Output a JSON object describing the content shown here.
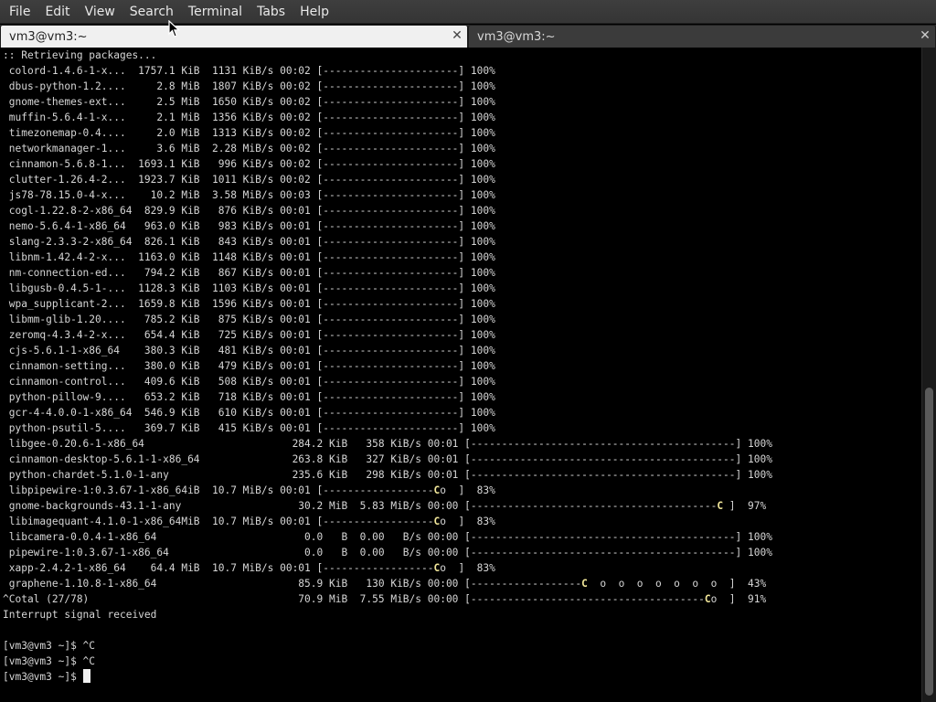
{
  "menu": [
    "File",
    "Edit",
    "View",
    "Search",
    "Terminal",
    "Tabs",
    "Help"
  ],
  "tabs": [
    {
      "title": "vm3@vm3:~",
      "active": true
    },
    {
      "title": "vm3@vm3:~",
      "active": false
    }
  ],
  "icons": {
    "tab_close": "close-icon",
    "pointer": "mouse-pointer-icon"
  },
  "colors": {
    "highlight": "#f2e79a",
    "text": "#d6d6d6",
    "background": "#000000"
  },
  "scrollbar": {
    "visible_fraction": 0.48,
    "position_fraction": 1.0
  },
  "terminal_lines": [
    ":: Retrieving packages...",
    " colord-1.4.6-1-x...  1757.1 KiB  1131 KiB/s 00:02 [----------------------] 100%",
    " dbus-python-1.2....     2.8 MiB  1807 KiB/s 00:02 [----------------------] 100%",
    " gnome-themes-ext...     2.5 MiB  1650 KiB/s 00:02 [----------------------] 100%",
    " muffin-5.6.4-1-x...     2.1 MiB  1356 KiB/s 00:02 [----------------------] 100%",
    " timezonemap-0.4....     2.0 MiB  1313 KiB/s 00:02 [----------------------] 100%",
    " networkmanager-1...     3.6 MiB  2.28 MiB/s 00:02 [----------------------] 100%",
    " cinnamon-5.6.8-1...  1693.1 KiB   996 KiB/s 00:02 [----------------------] 100%",
    " clutter-1.26.4-2...  1923.7 KiB  1011 KiB/s 00:02 [----------------------] 100%",
    " js78-78.15.0-4-x...    10.2 MiB  3.58 MiB/s 00:03 [----------------------] 100%",
    " cogl-1.22.8-2-x86_64  829.9 KiB   876 KiB/s 00:01 [----------------------] 100%",
    " nemo-5.6.4-1-x86_64   963.0 KiB   983 KiB/s 00:01 [----------------------] 100%",
    " slang-2.3.3-2-x86_64  826.1 KiB   843 KiB/s 00:01 [----------------------] 100%",
    " libnm-1.42.4-2-x...  1163.0 KiB  1148 KiB/s 00:01 [----------------------] 100%",
    " nm-connection-ed...   794.2 KiB   867 KiB/s 00:01 [----------------------] 100%",
    " libgusb-0.4.5-1-...  1128.3 KiB  1103 KiB/s 00:01 [----------------------] 100%",
    " wpa_supplicant-2...  1659.8 KiB  1596 KiB/s 00:01 [----------------------] 100%",
    " libmm-glib-1.20....   785.2 KiB   875 KiB/s 00:01 [----------------------] 100%",
    " zeromq-4.3.4-2-x...   654.4 KiB   725 KiB/s 00:01 [----------------------] 100%",
    " cjs-5.6.1-1-x86_64    380.3 KiB   481 KiB/s 00:01 [----------------------] 100%",
    " cinnamon-setting...   380.0 KiB   479 KiB/s 00:01 [----------------------] 100%",
    " cinnamon-control...   409.6 KiB   508 KiB/s 00:01 [----------------------] 100%",
    " python-pillow-9....   653.2 KiB   718 KiB/s 00:01 [----------------------] 100%",
    " gcr-4-4.0.0-1-x86_64  546.9 KiB   610 KiB/s 00:01 [----------------------] 100%",
    " python-psutil-5....   369.7 KiB   415 KiB/s 00:01 [----------------------] 100%",
    " libgee-0.20.6-1-x86_64                        284.2 KiB   358 KiB/s 00:01 [-------------------------------------------] 100%",
    " cinnamon-desktop-5.6.1-1-x86_64               263.8 KiB   327 KiB/s 00:01 [-------------------------------------------] 100%",
    " python-chardet-5.1.0-1-any                    235.6 KiB   298 KiB/s 00:01 [-------------------------------------------] 100%",
    " libpipewire-1:0.3.67-1-x86_64iB  10.7 MiB/s 00:01 [------------------Co  ]  83%",
    " gnome-backgrounds-43.1-1-any                   30.2 MiB  5.83 MiB/s 00:00 [----------------------------------------C ]  97%",
    " libimagequant-4.1.0-1-x86_64MiB  10.7 MiB/s 00:01 [------------------Co  ]  83%",
    " libcamera-0.0.4-1-x86_64                        0.0   B  0.00   B/s 00:00 [-------------------------------------------] 100%",
    " pipewire-1:0.3.67-1-x86_64                      0.0   B  0.00   B/s 00:00 [-------------------------------------------] 100%",
    " xapp-2.4.2-1-x86_64    64.4 MiB  10.7 MiB/s 00:01 [------------------Co  ]  83%",
    " graphene-1.10.8-1-x86_64                       85.9 KiB   130 KiB/s 00:00 [------------------C  o  o  o  o  o  o  o  ]  43%",
    "^Cotal (27/78)                                  70.9 MiB  7.55 MiB/s 00:00 [--------------------------------------Co  ]  91%",
    "Interrupt signal received",
    "",
    "[vm3@vm3 ~]$ ^C",
    "[vm3@vm3 ~]$ ^C",
    "[vm3@vm3 ~]$ "
  ]
}
